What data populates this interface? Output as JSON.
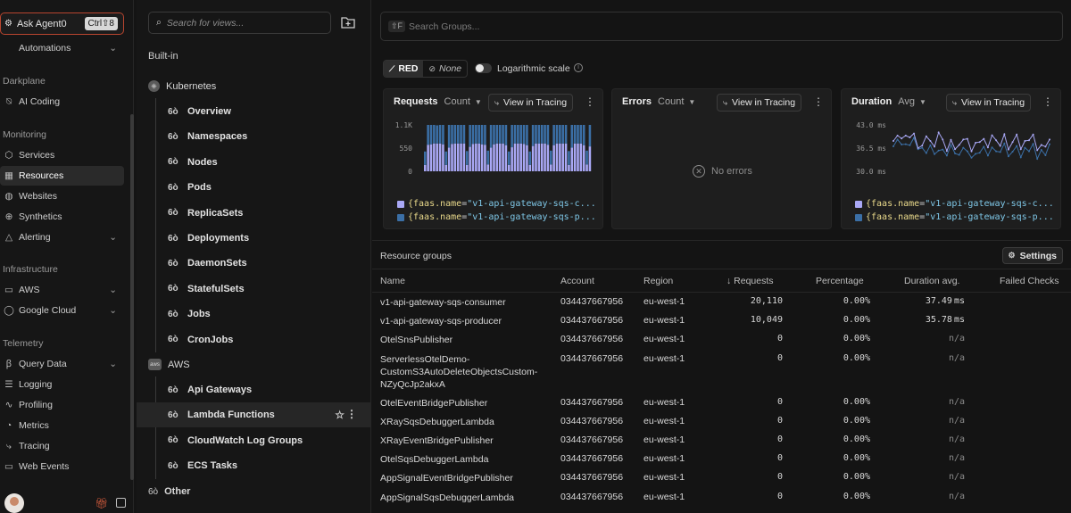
{
  "nav": {
    "ask_agent": {
      "label": "Ask Agent0",
      "shortcut": "Ctrl⇧8"
    },
    "automations": "Automations",
    "sections": [
      {
        "title": "Darkplane",
        "items": [
          "AI Coding"
        ]
      },
      {
        "title": "Monitoring",
        "items": [
          "Services",
          "Resources",
          "Websites",
          "Synthetics",
          "Alerting"
        ]
      },
      {
        "title": "Infrastructure",
        "items": [
          "AWS",
          "Google Cloud"
        ]
      },
      {
        "title": "Telemetry",
        "items": [
          "Query Data",
          "Logging",
          "Profiling",
          "Metrics",
          "Tracing",
          "Web Events"
        ]
      }
    ],
    "active": "Resources"
  },
  "views": {
    "search_placeholder": "Search for views...",
    "builtin": "Built-in",
    "kubernetes": {
      "title": "Kubernetes",
      "items": [
        "Overview",
        "Namespaces",
        "Nodes",
        "Pods",
        "ReplicaSets",
        "Deployments",
        "DaemonSets",
        "StatefulSets",
        "Jobs",
        "CronJobs"
      ]
    },
    "aws": {
      "title": "AWS",
      "items": [
        "Api Gateways",
        "Lambda Functions",
        "CloudWatch Log Groups",
        "ECS Tasks"
      ]
    },
    "active": "Lambda Functions",
    "other": "Other"
  },
  "main": {
    "search_groups_placeholder": "Search Groups...",
    "search_shortcut": "⇧F",
    "mode_red": "RED",
    "mode_none": "None",
    "log_scale": "Logarithmic scale",
    "view_in_tracing": "View in Tracing",
    "legend": {
      "key": "{faas.name",
      "eq": "=",
      "consumer": "\"v1-api-gateway-sqs-c...",
      "producer": "\"v1-api-gateway-sqs-p..."
    },
    "no_errors": "No errors",
    "resource_groups": "Resource groups",
    "settings": "Settings",
    "columns": [
      "Name",
      "Account",
      "Region",
      "Requests",
      "Percentage",
      "Duration avg.",
      "Failed Checks"
    ],
    "rows": [
      {
        "name": [
          "v1-api-gateway-sqs-consumer"
        ],
        "account": "034437667956",
        "region": "eu-west-1",
        "requests": "20,110",
        "percentage": "0.00%",
        "duration": "37.49",
        "unit": "ms"
      },
      {
        "name": [
          "v1-api-gateway-sqs-producer"
        ],
        "account": "034437667956",
        "region": "eu-west-1",
        "requests": "10,049",
        "percentage": "0.00%",
        "duration": "35.78",
        "unit": "ms"
      },
      {
        "name": [
          "OtelSnsPublisher"
        ],
        "account": "034437667956",
        "region": "eu-west-1",
        "requests": "0",
        "percentage": "0.00%",
        "duration": "n/a",
        "unit": ""
      },
      {
        "name": [
          "ServerlessOtelDemo-",
          "CustomS3AutoDeleteObjectsCustom-",
          "NZyQcJp2akxA"
        ],
        "account": "034437667956",
        "region": "eu-west-1",
        "requests": "0",
        "percentage": "0.00%",
        "duration": "n/a",
        "unit": ""
      },
      {
        "name": [
          "OtelEventBridgePublisher"
        ],
        "account": "034437667956",
        "region": "eu-west-1",
        "requests": "0",
        "percentage": "0.00%",
        "duration": "n/a",
        "unit": ""
      },
      {
        "name": [
          "XRaySqsDebuggerLambda"
        ],
        "account": "034437667956",
        "region": "eu-west-1",
        "requests": "0",
        "percentage": "0.00%",
        "duration": "n/a",
        "unit": ""
      },
      {
        "name": [
          "XRayEventBridgePublisher"
        ],
        "account": "034437667956",
        "region": "eu-west-1",
        "requests": "0",
        "percentage": "0.00%",
        "duration": "n/a",
        "unit": ""
      },
      {
        "name": [
          "OtelSqsDebuggerLambda"
        ],
        "account": "034437667956",
        "region": "eu-west-1",
        "requests": "0",
        "percentage": "0.00%",
        "duration": "n/a",
        "unit": ""
      },
      {
        "name": [
          "AppSignalEventBridgePublisher"
        ],
        "account": "034437667956",
        "region": "eu-west-1",
        "requests": "0",
        "percentage": "0.00%",
        "duration": "n/a",
        "unit": ""
      },
      {
        "name": [
          "AppSignalSqsDebuggerLambda"
        ],
        "account": "034437667956",
        "region": "eu-west-1",
        "requests": "0",
        "percentage": "0.00%",
        "duration": "n/a",
        "unit": ""
      }
    ]
  },
  "colors": {
    "consumer": "#a9a8f5",
    "producer": "#3b6fa6",
    "accent_border": "#b8452f"
  },
  "chart_data": [
    {
      "type": "bar",
      "title": "Requests",
      "aggregation": "Count",
      "ticks": [
        "1.1K",
        "550",
        "0"
      ],
      "ylim": [
        0,
        1100
      ],
      "stacked": true,
      "series": [
        {
          "name": "{faas.name=\"v1-api-gateway-sqs-c...",
          "values": [
            0,
            0,
            0,
            0,
            0,
            0,
            0,
            0,
            0,
            0,
            0,
            0,
            0,
            0,
            0,
            0,
            0,
            0,
            0,
            0,
            0,
            0,
            0,
            0,
            0,
            0,
            0,
            0,
            0,
            0,
            0,
            0,
            0,
            0,
            0,
            0,
            0,
            0,
            0,
            0,
            0,
            0,
            0,
            0,
            0,
            0,
            0,
            0,
            0,
            0,
            0,
            0,
            0,
            0,
            0,
            0
          ]
        },
        {
          "name": "{faas.name=\"v1-api-gateway-sqs-p...",
          "values": [
            0,
            0,
            0,
            0,
            0,
            0,
            0,
            0,
            0,
            0,
            0,
            0,
            0,
            0,
            0,
            0,
            0,
            0,
            0,
            0,
            0,
            0,
            0,
            0,
            0,
            0,
            0,
            0,
            0,
            0,
            0,
            0,
            0,
            0,
            0,
            0,
            0,
            0,
            0,
            0,
            0,
            0,
            0,
            0,
            0,
            0,
            0,
            0,
            0,
            0,
            0,
            0,
            0,
            0,
            0,
            0
          ]
        }
      ],
      "consumer": [
        150,
        630,
        640,
        660,
        660,
        660,
        640,
        150,
        560,
        650,
        660,
        660,
        660,
        660,
        150,
        580,
        650,
        660,
        660,
        640,
        630,
        160,
        560,
        640,
        660,
        660,
        660,
        620,
        150,
        570,
        660,
        660,
        660,
        650,
        620,
        150,
        600,
        660,
        660,
        660,
        660,
        630,
        160,
        620,
        660,
        660,
        660,
        660,
        150,
        560,
        660,
        660,
        660,
        620,
        160,
        590
      ],
      "producer": [
        320,
        470,
        460,
        440,
        430,
        440,
        460,
        320,
        540,
        450,
        440,
        440,
        440,
        440,
        330,
        520,
        450,
        440,
        440,
        460,
        470,
        330,
        540,
        460,
        440,
        440,
        440,
        480,
        320,
        530,
        440,
        440,
        440,
        450,
        480,
        320,
        500,
        440,
        440,
        440,
        440,
        470,
        330,
        480,
        440,
        440,
        440,
        440,
        330,
        540,
        440,
        440,
        440,
        480,
        330,
        510
      ]
    },
    {
      "type": "line",
      "title": "Errors",
      "aggregation": "Count",
      "series": []
    },
    {
      "type": "line",
      "title": "Duration",
      "aggregation": "Avg",
      "ticks": [
        "43.0 ms",
        "36.5 ms",
        "30.0 ms"
      ],
      "ylim": [
        30.0,
        43.0
      ],
      "series": [
        {
          "name": "{faas.name=\"v1-api-gateway-sqs-c...",
          "values": [
            38.5,
            40.0,
            39.2,
            40.0,
            39.5,
            40.6,
            36.5,
            37.2,
            39.8,
            38.5,
            36.9,
            40.9,
            38.9,
            35.7,
            38.8,
            36.2,
            37.4,
            38.9,
            39.1,
            35.6,
            38.0,
            38.2,
            39.1,
            36.7,
            40.1,
            38.7,
            37.1,
            40.4,
            36.1,
            38.2,
            40.3,
            36.2,
            38.5,
            38.7,
            40.3,
            35.9,
            37.4,
            36.9,
            38.9
          ]
        },
        {
          "name": "{faas.name=\"v1-api-gateway-sqs-p...",
          "values": [
            37.0,
            38.9,
            37.5,
            37.6,
            37.3,
            39.4,
            36.2,
            36.6,
            35.1,
            37.3,
            34.8,
            35.8,
            36.1,
            34.4,
            37.4,
            35.0,
            34.6,
            36.6,
            35.6,
            33.8,
            34.9,
            35.2,
            36.9,
            34.4,
            36.7,
            35.6,
            35.4,
            37.8,
            34.2,
            35.5,
            37.1,
            33.9,
            36.6,
            35.6,
            37.7,
            33.5,
            36.0,
            34.5,
            37.6
          ]
        }
      ]
    }
  ]
}
